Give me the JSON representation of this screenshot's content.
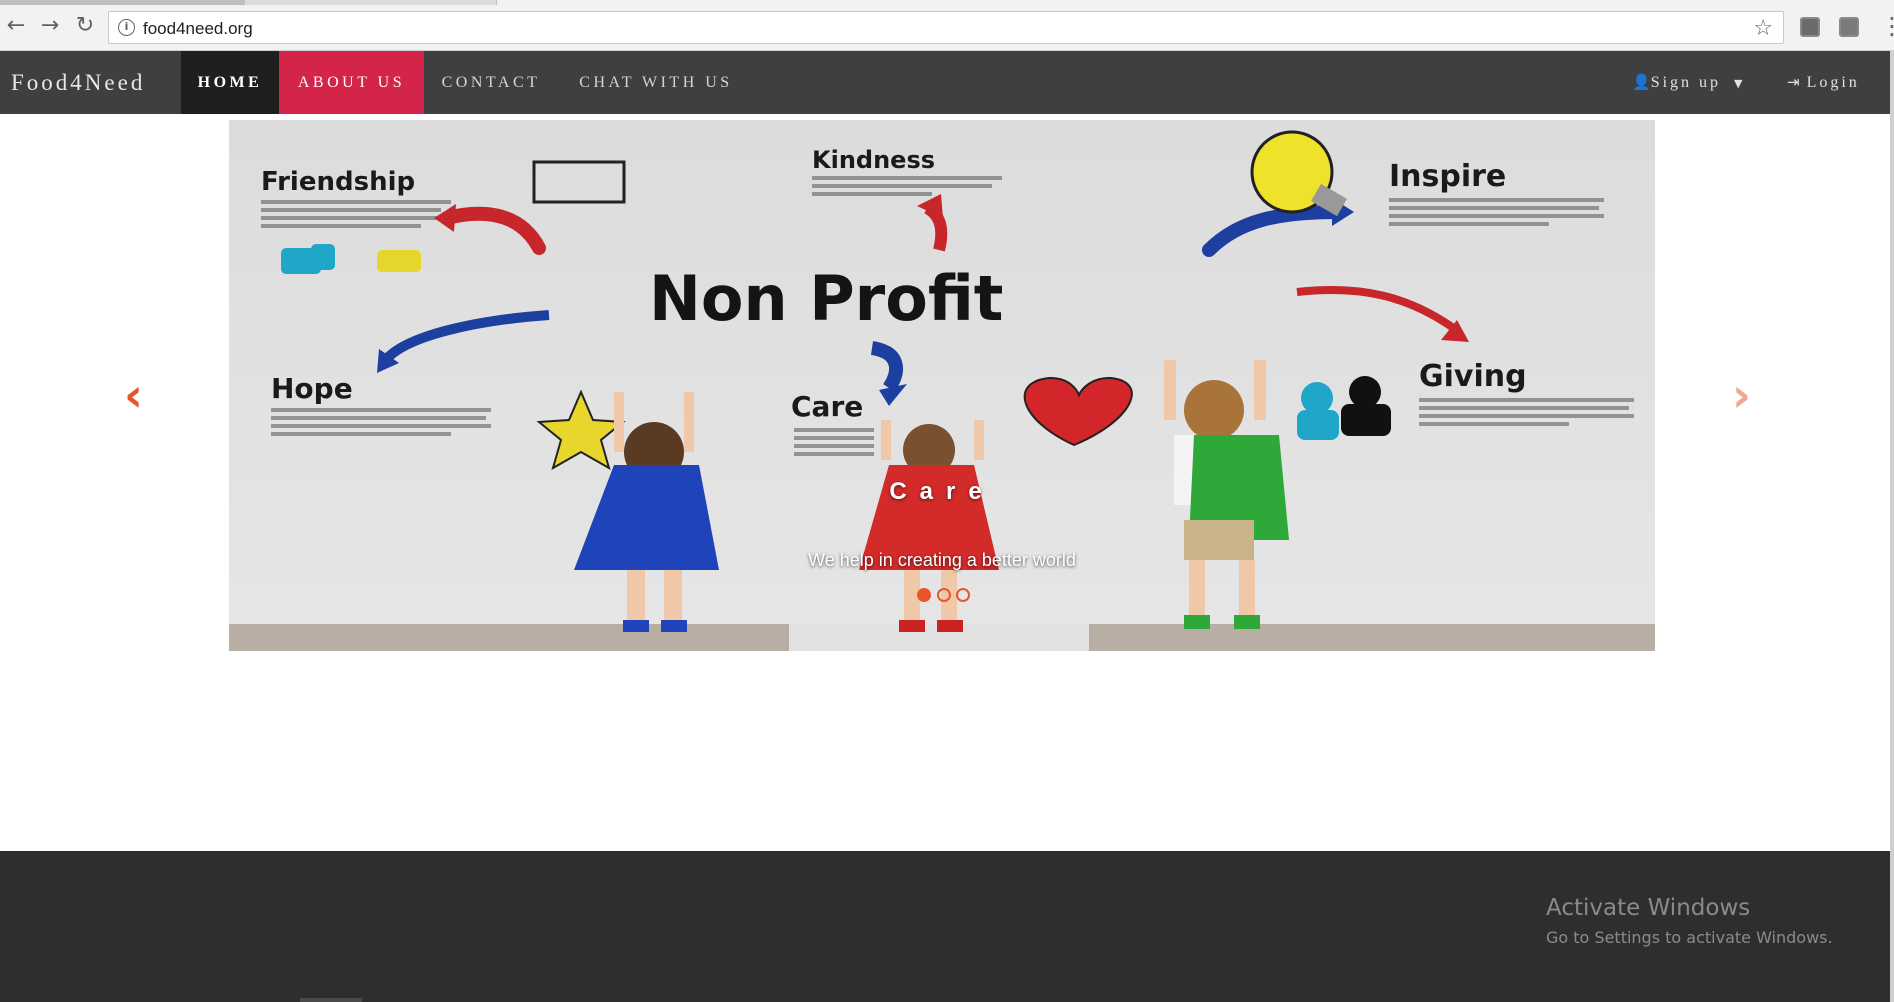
{
  "browser": {
    "url": "food4need.org",
    "back_icon": "arrow-left-icon",
    "forward_icon": "arrow-right-icon",
    "reload_icon": "reload-icon",
    "info_icon": "info-icon",
    "star_icon": "star-icon"
  },
  "navbar": {
    "brand": "Food4Need",
    "items": [
      {
        "label": "HOME"
      },
      {
        "label": "ABOUT US"
      },
      {
        "label": "CONTACT"
      },
      {
        "label": "CHAT WITH US"
      }
    ],
    "signup_label": "Sign up",
    "login_label": "Login",
    "accent_color": "#d4244a",
    "active_color": "#1f1f1f",
    "bar_color": "#3f3f41"
  },
  "carousel": {
    "slide_words": {
      "center": "Non Profit",
      "friendship": "Friendship",
      "kindness": "Kindness",
      "inspire": "Inspire",
      "hope": "Hope",
      "care": "Care",
      "giving": "Giving"
    },
    "caption_title": "Care",
    "caption_sub": "We help in creating a better world",
    "slide_count": 3,
    "active_index": 0,
    "indicator_color": "#e8552b"
  },
  "overlay": {
    "title": "Activate Windows",
    "subtitle": "Go to Settings to activate Windows."
  }
}
